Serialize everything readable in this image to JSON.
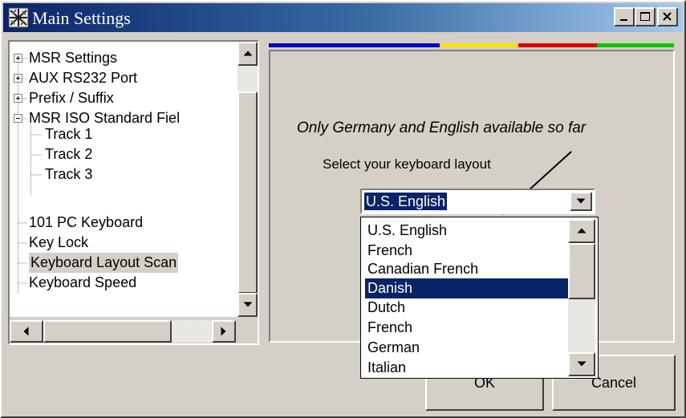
{
  "window": {
    "title": "Main Settings",
    "controls": {
      "minimize": "minimize-icon",
      "maximize": "maximize-icon",
      "close": "close-icon"
    }
  },
  "tree": {
    "items": [
      {
        "label": "MSR Settings",
        "expander": "+"
      },
      {
        "label": "AUX RS232 Port",
        "expander": "+"
      },
      {
        "label": "Prefix / Suffix",
        "expander": "+"
      },
      {
        "label": "MSR ISO Standard Fiel",
        "expander": "-"
      },
      {
        "label": "Track 1",
        "expander": ""
      },
      {
        "label": "Track 2",
        "expander": ""
      },
      {
        "label": "Track 3",
        "expander": ""
      },
      {
        "label": "101 PC Keyboard",
        "expander": ""
      },
      {
        "label": "Key Lock",
        "expander": ""
      },
      {
        "label": "Keyboard Layout Scan",
        "expander": "",
        "selected": true
      },
      {
        "label": "Keyboard Speed",
        "expander": ""
      }
    ]
  },
  "color_strip": [
    "#0000c8",
    "#ffe000",
    "#e00000",
    "#00c800"
  ],
  "panel": {
    "hint": "Only Germany and English available so far",
    "select_label": "Select your keyboard layout",
    "layout_combo": {
      "value": "U.S. English",
      "options": [
        "U.S. English",
        "French",
        "Canadian French",
        "Danish",
        "Dutch",
        "French",
        "German",
        "Italian"
      ],
      "highlighted": "Danish"
    }
  },
  "buttons": {
    "ok": "OK",
    "cancel": "Cancel"
  },
  "colors": {
    "face": "#d4d0c8",
    "selection": "#0a246a",
    "title_start": "#0a246a",
    "title_end": "#a6caf0"
  }
}
